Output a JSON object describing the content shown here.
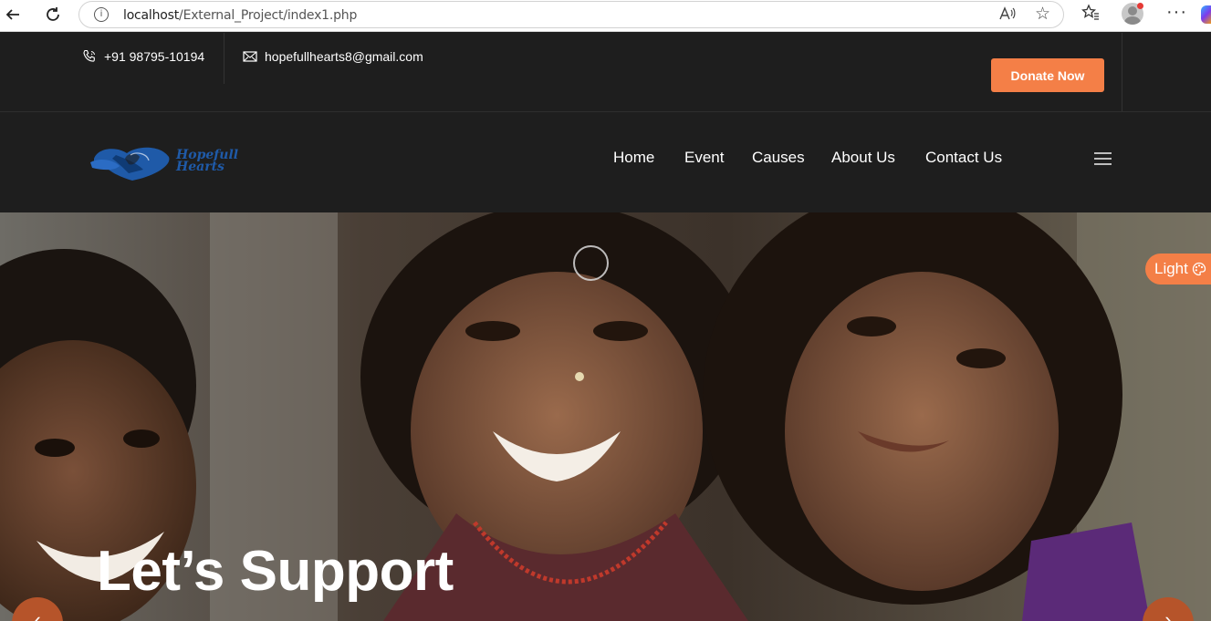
{
  "browser": {
    "url_host": "localhost",
    "url_path": "/External_Project/index1.php",
    "read_aloud_label": "A͇",
    "info_glyph": "i"
  },
  "topbar": {
    "phone": "+91 98795-10194",
    "email": "hopefullhearts8@gmail.com",
    "donate_label": "Donate Now"
  },
  "logo": {
    "line1": "Hopefull",
    "line2": "Hearts"
  },
  "nav": {
    "items": [
      "Home",
      "Event",
      "Causes",
      "About Us",
      "Contact Us"
    ]
  },
  "hero": {
    "title": "Let’s Support"
  },
  "theme_toggle": {
    "label": "Light"
  },
  "colors": {
    "accent": "#f47f47",
    "background": "#1e1e1e",
    "logo_blue": "#1f5aa8"
  }
}
